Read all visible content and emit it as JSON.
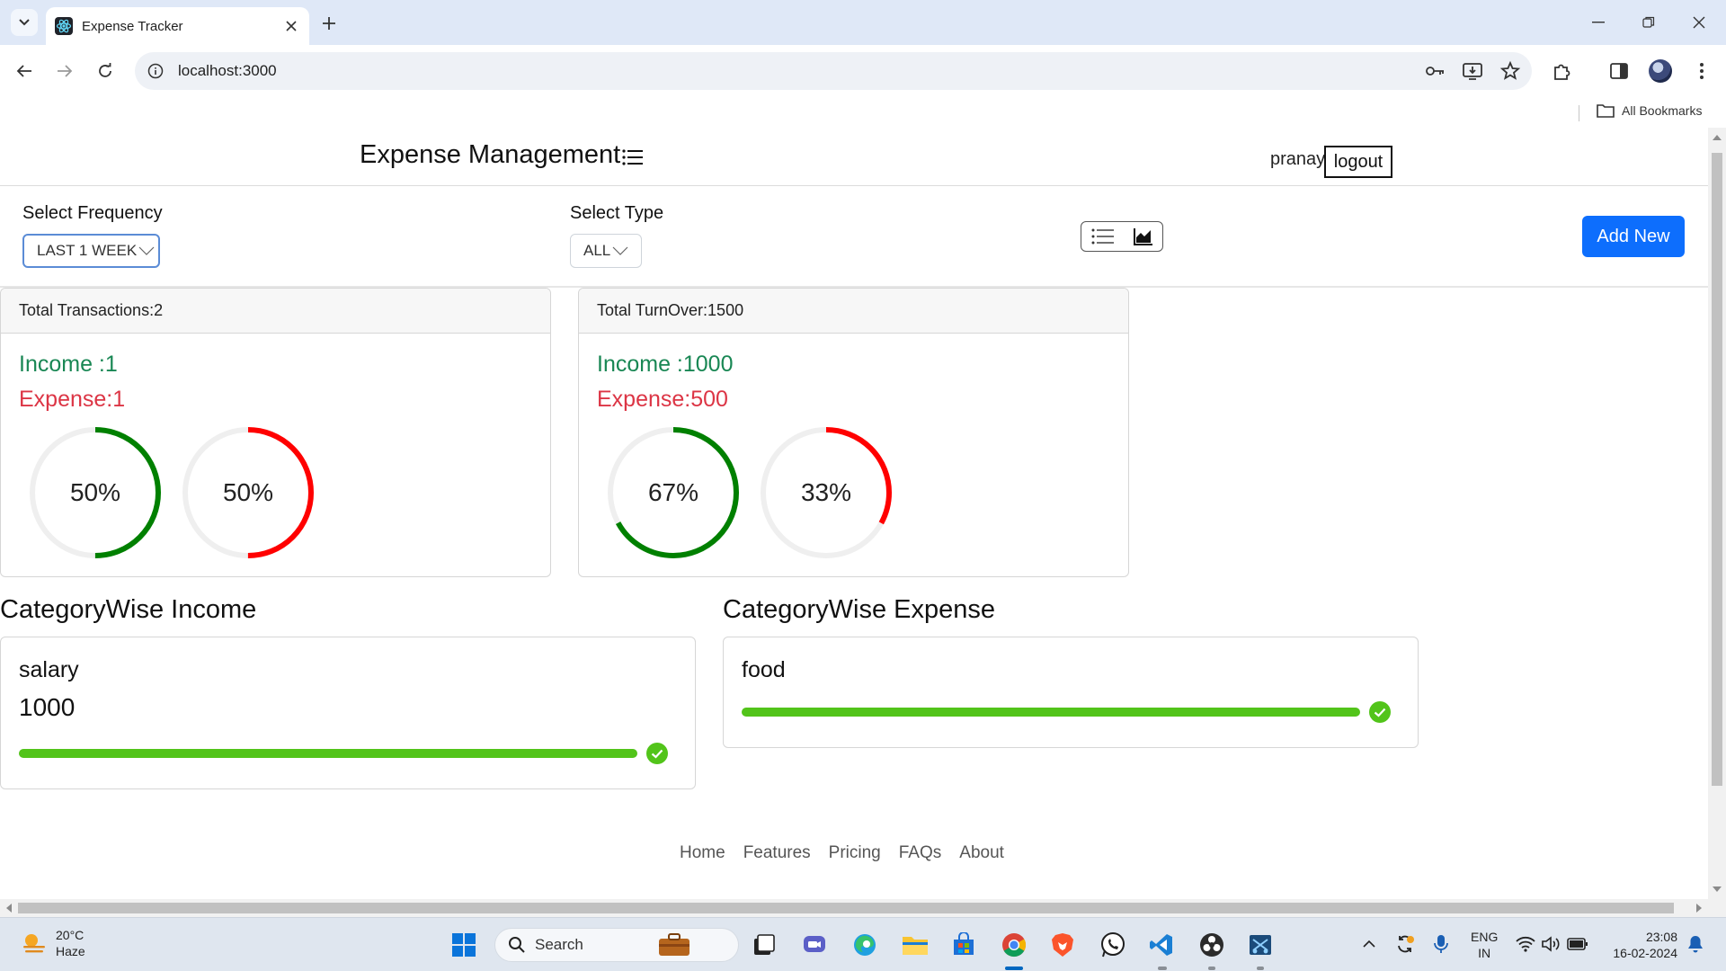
{
  "browser": {
    "tab_title": "Expense Tracker",
    "url": "localhost:3000",
    "bookmarks_label": "All Bookmarks"
  },
  "header": {
    "brand": "Expense Management",
    "user": "pranay",
    "logout_label": "logout"
  },
  "filters": {
    "frequency_label": "Select Frequency",
    "frequency_value": "LAST 1 WEEK",
    "type_label": "Select Type",
    "type_value": "ALL",
    "add_new_label": "Add New"
  },
  "summary": {
    "transactions": {
      "header": "Total Transactions:2",
      "income": "Income :1",
      "expense": "Expense:1",
      "income_pct": 50,
      "expense_pct": 50,
      "income_pct_label": "50%",
      "expense_pct_label": "50%"
    },
    "turnover": {
      "header": "Total TurnOver:1500",
      "income": "Income :1000",
      "expense": "Expense:500",
      "income_pct": 67,
      "expense_pct": 33,
      "income_pct_label": "67%",
      "expense_pct_label": "33%"
    }
  },
  "category_income": {
    "title": "CategoryWise Income",
    "items": [
      {
        "name": "salary",
        "amount": "1000",
        "progress": 100
      }
    ]
  },
  "category_expense": {
    "title": "CategoryWise Expense",
    "items": [
      {
        "name": "food",
        "progress": 100
      }
    ]
  },
  "footer": {
    "links": [
      "Home",
      "Features",
      "Pricing",
      "FAQs",
      "About"
    ]
  },
  "taskbar": {
    "temperature": "20°C",
    "weather": "Haze",
    "search_placeholder": "Search",
    "lang_top": "ENG",
    "lang_bottom": "IN",
    "time": "23:08",
    "date": "16-02-2024"
  },
  "colors": {
    "income": "#198754",
    "expense": "#dc3545",
    "ring_income": "#008000",
    "ring_expense": "#ff0000",
    "progress": "#52c41a",
    "primary": "#0d6efd"
  }
}
